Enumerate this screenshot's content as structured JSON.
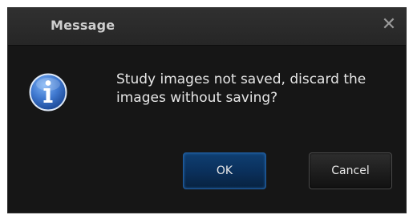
{
  "dialog": {
    "title": "Message",
    "close_glyph": "✕",
    "icon": "info-icon",
    "message": "Study images not saved, discard the images without saving?",
    "buttons": {
      "ok_label": "OK",
      "cancel_label": "Cancel"
    }
  },
  "colors": {
    "dialog_background": "#161616",
    "titlebar_background": "#2b2b2b",
    "title_text": "#cfcfcf",
    "message_text": "#e6e6e6",
    "ok_button": "#0a2f5a",
    "cancel_button": "#1c1c1c",
    "info_icon": "#3f78cf"
  }
}
